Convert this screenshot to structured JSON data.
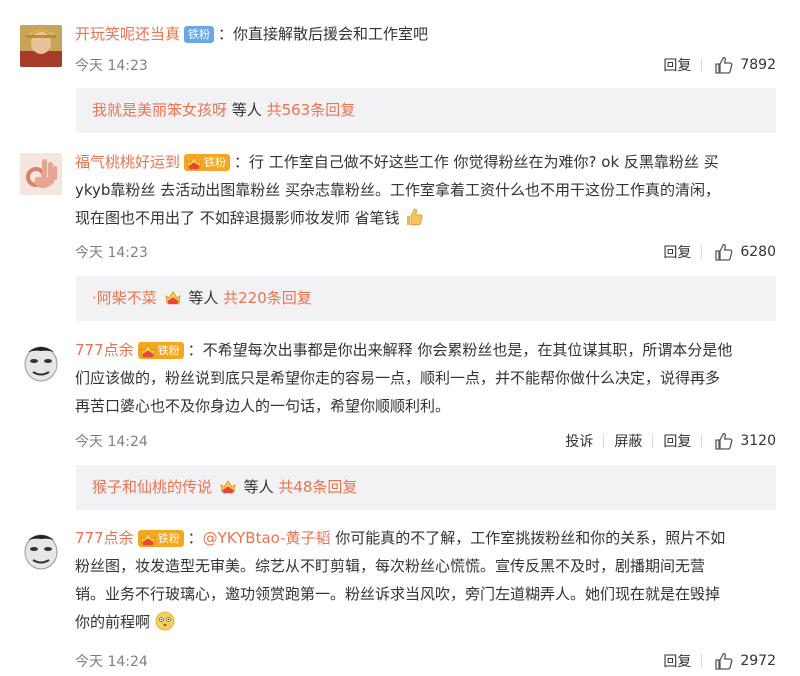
{
  "comments": [
    {
      "user": "开玩笑呢还当真",
      "badge": "铁粉",
      "text": "：你直接解散后援会和工作室吧",
      "time": "今天 14:23",
      "reply_label": "回复",
      "likes": "7892",
      "replies": {
        "user": "我就是美丽笨女孩呀",
        "mid": " 等人 ",
        "count": "共563条回复"
      }
    },
    {
      "user": "福气桃桃好运到",
      "badge": "铁粉",
      "text_line1": "：行 工作室自己做不好这些工作 你觉得粉丝在为难你? ok 反黑靠粉丝 买",
      "text_line2": "ykyb靠粉丝 去活动出图靠粉丝 买杂志靠粉丝。工作室拿着工资什么也不用干这份工作真的清闲，",
      "text_line3": "现在图也不用出了 不如辞退摄影师妆发师 省笔钱",
      "time": "今天 14:23",
      "reply_label": "回复",
      "likes": "6280",
      "replies": {
        "user": "阿柴不菜",
        "mid": " 等人 ",
        "count": "共220条回复"
      }
    },
    {
      "user": "777点余",
      "badge": "铁粉",
      "text_line1": "：不希望每次出事都是你出来解释 你会累粉丝也是，在其位谋其职，所谓本分是他",
      "text_line2": "们应该做的，粉丝说到底只是希望你走的容易一点，顺利一点，并不能帮你做什么决定，说得再多",
      "text_line3": "再苦口婆心也不及你身边人的一句话，希望你顺顺利利。",
      "time": "今天 14:24",
      "report_label": "投诉",
      "block_label": "屏蔽",
      "reply_label": "回复",
      "likes": "3120",
      "replies": {
        "user": "猴子和仙桃的传说",
        "mid": " 等人 ",
        "count": "共48条回复"
      }
    },
    {
      "user": "777点余",
      "badge": "铁粉",
      "mention": "@YKYBtao-黄子韬",
      "text_line1": "  你可能真的不了解，工作室挑拨粉丝和你的关系，照片不如",
      "text_line2": "粉丝图，妆发造型无审美。综艺从不盯剪辑，每次粉丝心慌慌。宣传反黑不及时，剧播期间无营",
      "text_line3": "销。业务不行玻璃心，邀功领赏跑第一。粉丝诉求当风吹，旁门左道糊弄人。她们现在就是在毁掉",
      "text_line4": "你的前程啊",
      "time": "今天 14:24",
      "reply_label": "回复",
      "likes": "2972"
    }
  ],
  "colors": {
    "username": "#eb7350",
    "reply_bg": "#f2f2f5",
    "time": "#808080",
    "badge_blue": "#6aa6e8",
    "badge_gold": "#f5a623"
  }
}
